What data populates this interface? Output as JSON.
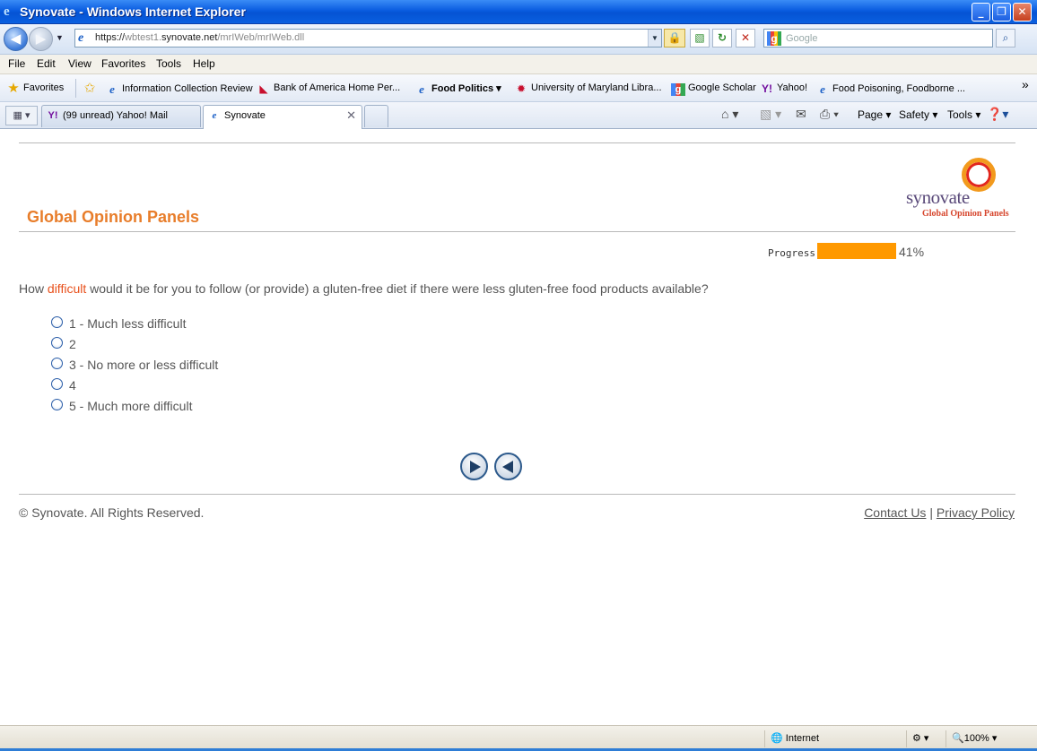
{
  "window": {
    "title": "Synovate - Windows Internet Explorer",
    "buttons": {
      "minimize": "_",
      "maximize": "❐",
      "close": "✕"
    }
  },
  "address_bar": {
    "url_scheme": "https://",
    "url_sub": "wbtest1.",
    "url_domain": "synovate.net",
    "url_path": "/mrIWeb/mrIWeb.dll",
    "search_placeholder": "Google",
    "search_engine_glyph": "g"
  },
  "menu": [
    "File",
    "Edit",
    "View",
    "Favorites",
    "Tools",
    "Help"
  ],
  "favorites_bar": {
    "label": "Favorites",
    "items": [
      {
        "label": "Information Collection Review",
        "icon": "ie-page-icon"
      },
      {
        "label": "Bank of America  Home  Per...",
        "icon": "bofa-icon"
      },
      {
        "label": "Food Politics",
        "icon": "ie-page-icon"
      },
      {
        "label": "University of Maryland Libra...",
        "icon": "umd-icon"
      },
      {
        "label": "Google Scholar",
        "icon": "google-icon"
      },
      {
        "label": "Yahoo!",
        "icon": "yahoo-icon"
      },
      {
        "label": "Food Poisoning, Foodborne ...",
        "icon": "ie-page-icon"
      }
    ],
    "overflow": "»"
  },
  "tabs": [
    {
      "label": "(99 unread) Yahoo! Mail",
      "active": false
    },
    {
      "label": "Synovate",
      "active": true
    }
  ],
  "command_bar": {
    "page": "Page",
    "safety": "Safety",
    "tools": "Tools"
  },
  "survey": {
    "panel_title": "Global Opinion Panels",
    "logo_brand": "synovate",
    "logo_sub": "Global Opinion Panels",
    "progress_label": "Progress:",
    "progress_value": 41,
    "progress_text": "41%",
    "question_pre": "How ",
    "question_highlight": "difficult",
    "question_post": " would it be for you to follow (or provide) a gluten-free diet if there were less gluten-free food products available?",
    "options": [
      "1 - Much less difficult",
      "2",
      "3 - No more or less difficult",
      "4",
      "5 - Much more difficult"
    ],
    "footer_copyright": "© Synovate. All Rights Reserved.",
    "contact_link": "Contact Us",
    "link_separator": " | ",
    "privacy_link": "Privacy Policy"
  },
  "status_bar": {
    "zone": "Internet",
    "zoom": "100%"
  },
  "colors": {
    "accent_orange": "#e87d2a",
    "progress_fill": "#ff9900",
    "highlight": "#e8501b"
  }
}
